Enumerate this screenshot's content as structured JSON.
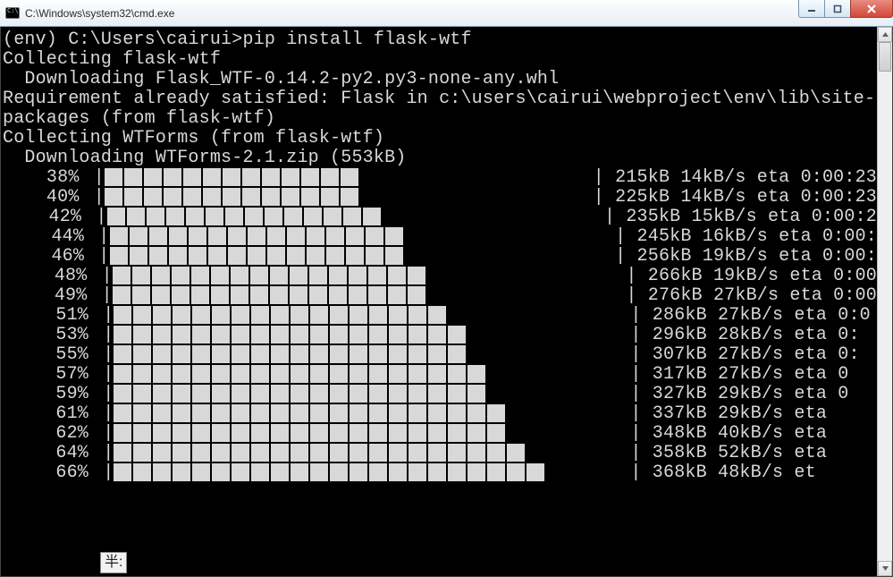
{
  "window": {
    "title": "C:\\Windows\\system32\\cmd.exe"
  },
  "intro_lines": [
    "",
    "(env) C:\\Users\\cairui>pip install flask-wtf",
    "Collecting flask-wtf",
    "  Downloading Flask_WTF-0.14.2-py2.py3-none-any.whl",
    "Requirement already satisfied: Flask in c:\\users\\cairui\\webproject\\env\\lib\\site-",
    "packages (from flask-wtf)",
    "Collecting WTForms (from flask-wtf)",
    "  Downloading WTForms-2.1.zip (553kB)"
  ],
  "progress_rows": [
    {
      "pct": "38%",
      "blocks": 13,
      "tail": "| 215kB 14kB/s eta 0:00:23"
    },
    {
      "pct": "40%",
      "blocks": 13,
      "tail": "| 225kB 14kB/s eta 0:00:23"
    },
    {
      "pct": "42%",
      "blocks": 14,
      "tail": "| 235kB 15kB/s eta 0:00:2"
    },
    {
      "pct": "44%",
      "blocks": 15,
      "tail": "| 245kB 16kB/s eta 0:00:"
    },
    {
      "pct": "46%",
      "blocks": 15,
      "tail": "| 256kB 19kB/s eta 0:00:"
    },
    {
      "pct": "48%",
      "blocks": 16,
      "tail": "| 266kB 19kB/s eta 0:00"
    },
    {
      "pct": "49%",
      "blocks": 16,
      "tail": "| 276kB 27kB/s eta 0:00"
    },
    {
      "pct": "51%",
      "blocks": 17,
      "tail": "| 286kB 27kB/s eta 0:0"
    },
    {
      "pct": "53%",
      "blocks": 18,
      "tail": "| 296kB 28kB/s eta 0:"
    },
    {
      "pct": "55%",
      "blocks": 18,
      "tail": "| 307kB 27kB/s eta 0:"
    },
    {
      "pct": "57%",
      "blocks": 19,
      "tail": "| 317kB 27kB/s eta 0"
    },
    {
      "pct": "59%",
      "blocks": 19,
      "tail": "| 327kB 29kB/s eta 0"
    },
    {
      "pct": "61%",
      "blocks": 20,
      "tail": "| 337kB 29kB/s eta "
    },
    {
      "pct": "62%",
      "blocks": 20,
      "tail": "| 348kB 40kB/s eta "
    },
    {
      "pct": "64%",
      "blocks": 21,
      "tail": "| 358kB 52kB/s eta"
    },
    {
      "pct": "66%",
      "blocks": 22,
      "tail": "| 368kB 48kB/s et"
    }
  ],
  "ime": {
    "text": "半:"
  },
  "colors": {
    "bg": "#000000",
    "fg": "#d8d8d8",
    "close": "#d1493a"
  }
}
